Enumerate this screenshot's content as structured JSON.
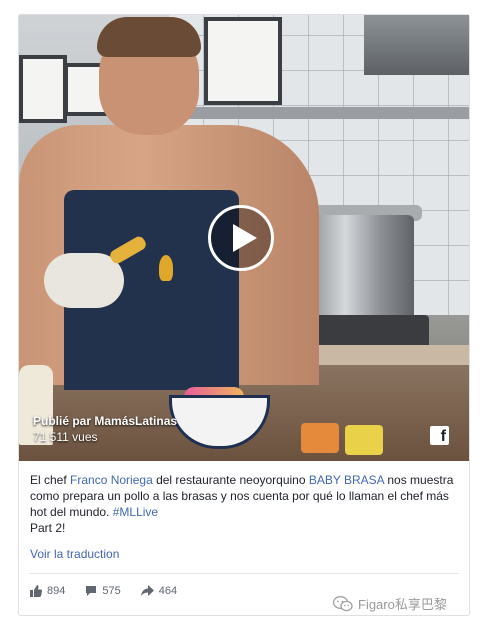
{
  "video": {
    "publisher_prefix": "Publié par",
    "publisher_name": "MamásLatinas",
    "views": "71 511 vues",
    "play_icon": "play-icon",
    "brand_icon": "facebook-f-icon"
  },
  "post": {
    "text_1": "El chef ",
    "chef_link": "Franco Noriega",
    "text_2": " del restaurante neoyorquino ",
    "restaurant_link": "BABY BRASA",
    "text_3": " nos muestra como prepara un pollo a las brasas y nos cuenta por qué lo llaman el chef más hot del mundo. ",
    "hashtag": "#MLLive",
    "part": "Part 2!",
    "translate": "Voir la traduction"
  },
  "actions": [
    {
      "icon": "thumbs-up-icon",
      "count": "894"
    },
    {
      "icon": "comment-icon",
      "count": "575"
    },
    {
      "icon": "share-arrow-icon",
      "count": "464"
    }
  ],
  "watermark": {
    "icon": "wechat-icon",
    "text": "Figaro私享巴黎"
  },
  "colors": {
    "link": "#4267b2",
    "text": "#1d2129",
    "muted": "#606770"
  }
}
